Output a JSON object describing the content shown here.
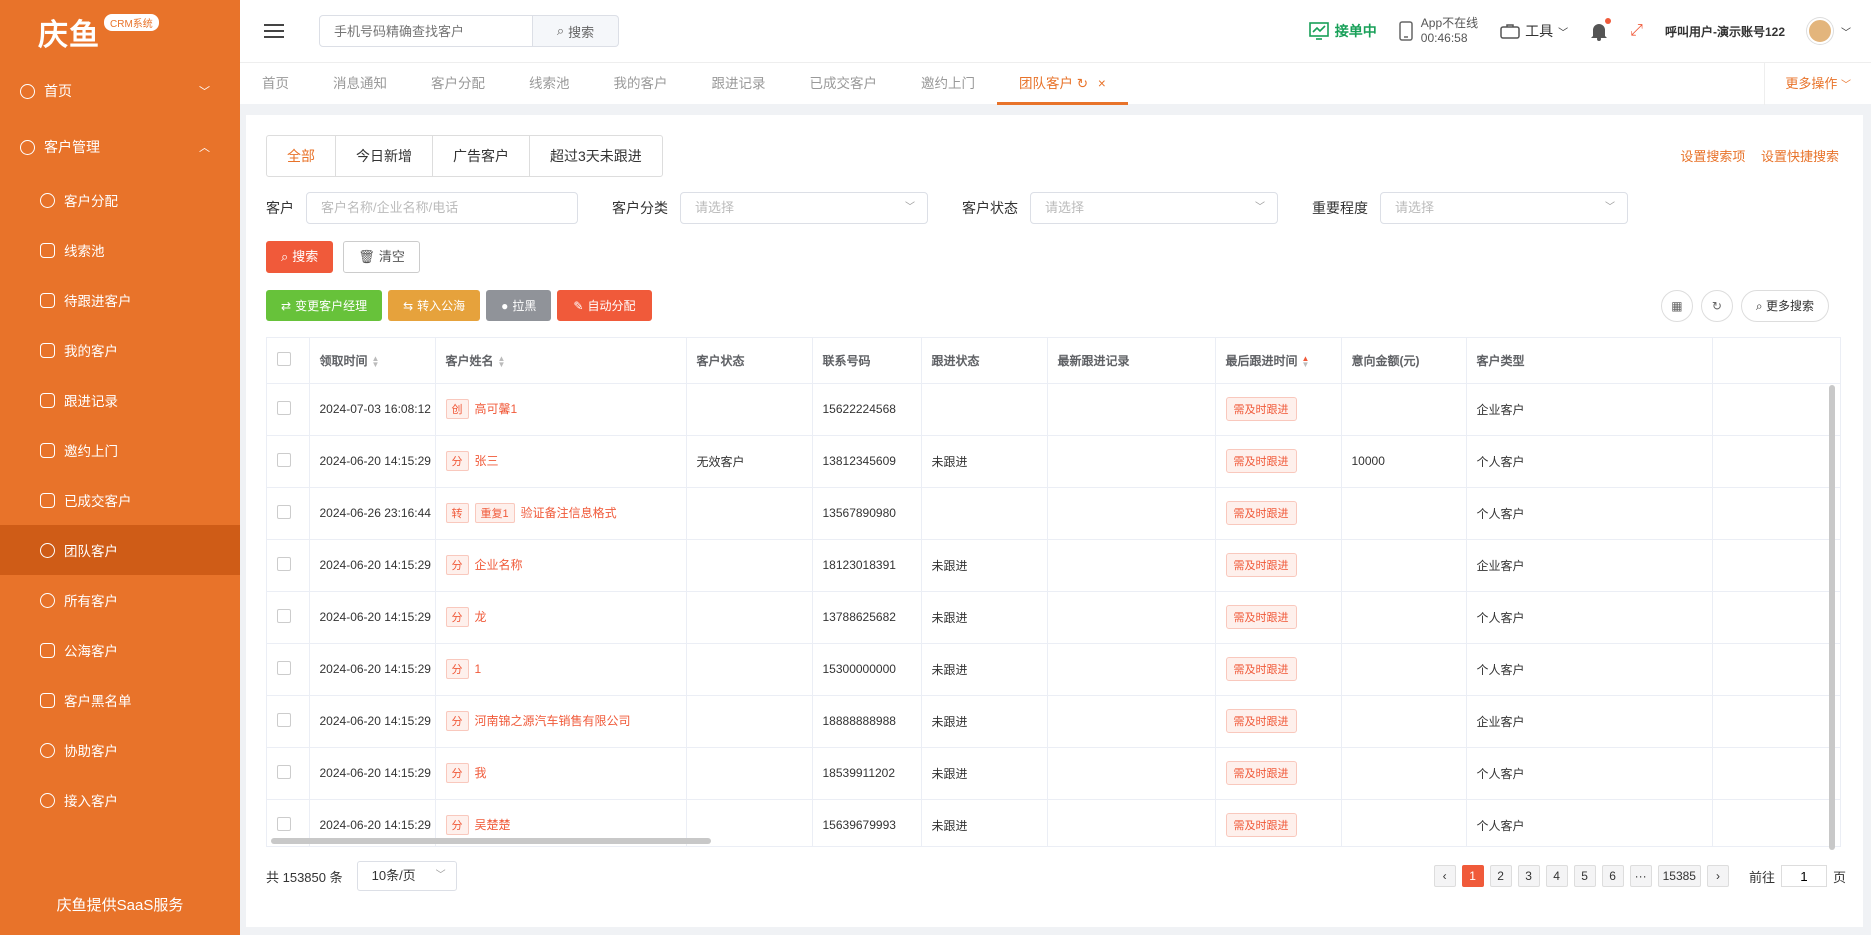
{
  "colors": {
    "brand": "#e8732a",
    "accent": "#f05a3a",
    "green": "#67c23a"
  },
  "logo": {
    "text": "庆鱼",
    "badge": "CRM系统"
  },
  "sidebar": {
    "home": "首页",
    "customer_mgmt": "客户管理",
    "items": [
      {
        "label": "客户分配",
        "icon": "user-icon"
      },
      {
        "label": "线索池",
        "icon": "grid-icon"
      },
      {
        "label": "待跟进客户",
        "icon": "phone-icon"
      },
      {
        "label": "我的客户",
        "icon": "doc-icon"
      },
      {
        "label": "跟进记录",
        "icon": "doc-icon"
      },
      {
        "label": "邀约上门",
        "icon": "tag-icon"
      },
      {
        "label": "已成交客户",
        "icon": "tag-icon"
      },
      {
        "label": "团队客户",
        "icon": "team-icon"
      },
      {
        "label": "所有客户",
        "icon": "user-icon"
      },
      {
        "label": "公海客户",
        "icon": "doc-icon"
      },
      {
        "label": "客户黑名单",
        "icon": "doc-icon"
      },
      {
        "label": "协助客户",
        "icon": "team-icon"
      },
      {
        "label": "接入客户",
        "icon": "user-icon"
      }
    ],
    "footer": "庆鱼提供SaaS服务"
  },
  "topbar": {
    "search_placeholder": "手机号码精确查找客户",
    "search_btn": "搜索",
    "receiving": "接单中",
    "app_status": "App不在线",
    "app_time": "00:46:58",
    "tools": "工具",
    "user": "呼叫用户-演示账号122"
  },
  "tabs": [
    "首页",
    "消息通知",
    "客户分配",
    "线索池",
    "我的客户",
    "跟进记录",
    "已成交客户",
    "邀约上门",
    "团队客户"
  ],
  "more_ops": "更多操作",
  "cat_tabs": [
    "全部",
    "今日新增",
    "广告客户",
    "超过3天未跟进"
  ],
  "top_links": {
    "set_search": "设置搜索项",
    "set_quick": "设置快捷搜索"
  },
  "filters": {
    "customer_label": "客户",
    "customer_placeholder": "客户名称/企业名称/电话",
    "category_label": "客户分类",
    "status_label": "客户状态",
    "importance_label": "重要程度",
    "select_placeholder": "请选择"
  },
  "buttons": {
    "search": "搜索",
    "clear": "清空",
    "change_mgr": "变更客户经理",
    "to_pool": "转入公海",
    "block": "拉黑",
    "auto_assign": "自动分配",
    "more_search": "更多搜索"
  },
  "table": {
    "headers": [
      "领取时间",
      "客户姓名",
      "客户状态",
      "联系号码",
      "跟进状态",
      "最新跟进记录",
      "最后跟进时间",
      "意向金额(元)",
      "客户类型"
    ],
    "rows": [
      {
        "time": "2024-07-03 16:08:12",
        "tags": [
          "创"
        ],
        "name": "高可馨1",
        "status": "",
        "phone": "15622224568",
        "follow": "",
        "latest": "",
        "last": "需及时跟进",
        "amount": "",
        "type": "企业客户"
      },
      {
        "time": "2024-06-20 14:15:29",
        "tags": [
          "分"
        ],
        "name": "张三",
        "status": "无效客户",
        "phone": "13812345609",
        "follow": "未跟进",
        "latest": "",
        "last": "需及时跟进",
        "amount": "10000",
        "type": "个人客户"
      },
      {
        "time": "2024-06-26 23:16:44",
        "tags": [
          "转",
          "重复1"
        ],
        "name": "验证备注信息格式",
        "status": "",
        "phone": "13567890980",
        "follow": "",
        "latest": "",
        "last": "需及时跟进",
        "amount": "",
        "type": "个人客户"
      },
      {
        "time": "2024-06-20 14:15:29",
        "tags": [
          "分"
        ],
        "name": "企业名称",
        "status": "",
        "phone": "18123018391",
        "follow": "未跟进",
        "latest": "",
        "last": "需及时跟进",
        "amount": "",
        "type": "企业客户"
      },
      {
        "time": "2024-06-20 14:15:29",
        "tags": [
          "分"
        ],
        "name": "龙",
        "status": "",
        "phone": "13788625682",
        "follow": "未跟进",
        "latest": "",
        "last": "需及时跟进",
        "amount": "",
        "type": "个人客户"
      },
      {
        "time": "2024-06-20 14:15:29",
        "tags": [
          "分"
        ],
        "name": "1",
        "status": "",
        "phone": "15300000000",
        "follow": "未跟进",
        "latest": "",
        "last": "需及时跟进",
        "amount": "",
        "type": "个人客户"
      },
      {
        "time": "2024-06-20 14:15:29",
        "tags": [
          "分"
        ],
        "name": "河南锦之源汽车销售有限公司",
        "status": "",
        "phone": "18888888988",
        "follow": "未跟进",
        "latest": "",
        "last": "需及时跟进",
        "amount": "",
        "type": "企业客户"
      },
      {
        "time": "2024-06-20 14:15:29",
        "tags": [
          "分"
        ],
        "name": "我",
        "status": "",
        "phone": "18539911202",
        "follow": "未跟进",
        "latest": "",
        "last": "需及时跟进",
        "amount": "",
        "type": "个人客户"
      },
      {
        "time": "2024-06-20 14:15:29",
        "tags": [
          "分"
        ],
        "name": "吴楚楚",
        "status": "",
        "phone": "15639679993",
        "follow": "未跟进",
        "latest": "",
        "last": "需及时跟进",
        "amount": "",
        "type": "个人客户"
      }
    ]
  },
  "footer": {
    "total": "共 153850 条",
    "page_size": "10条/页",
    "pages": [
      "1",
      "2",
      "3",
      "4",
      "5",
      "6",
      "···",
      "15385"
    ],
    "goto_prefix": "前往",
    "goto_value": "1",
    "goto_suffix": "页"
  }
}
